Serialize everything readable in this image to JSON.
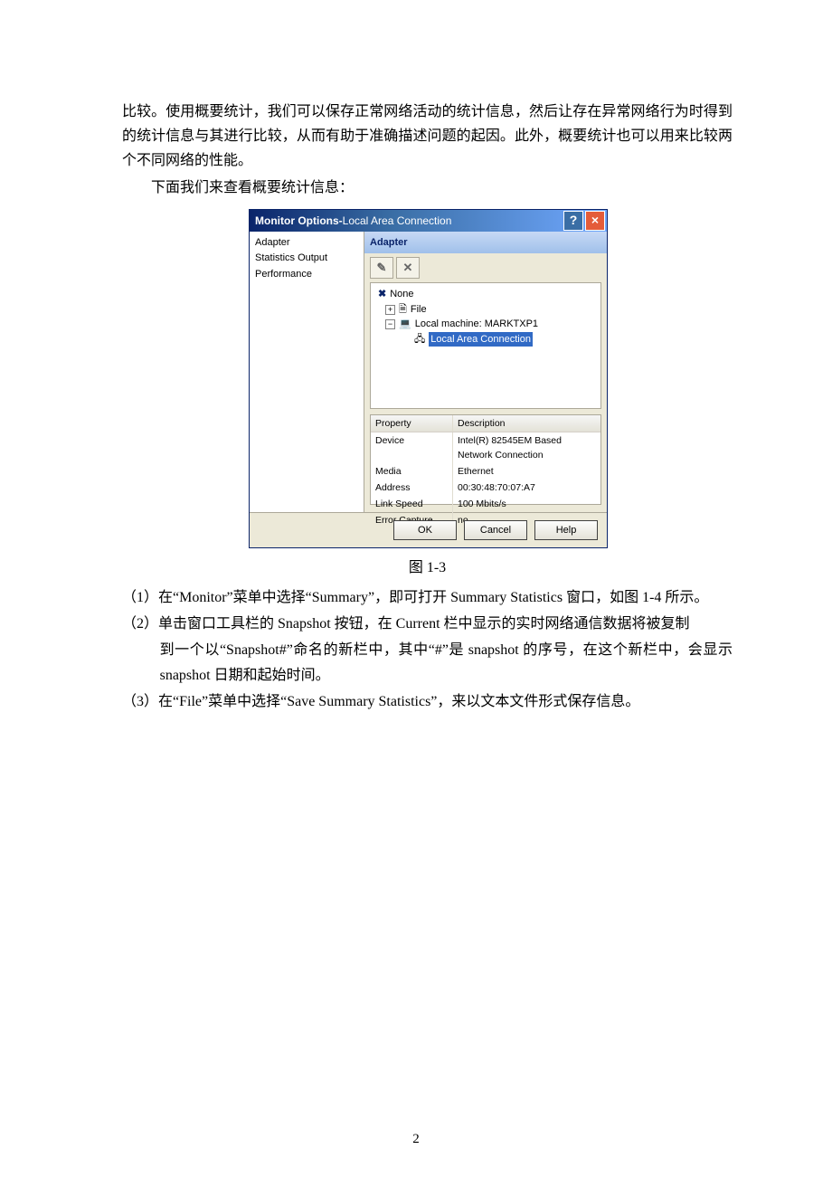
{
  "para1": "比较。使用概要统计，我们可以保存正常网络活动的统计信息，然后让存在异常网络行为时得到的统计信息与其进行比较，从而有助于准确描述问题的起因。此外，概要统计也可以用来比较两个不同网络的性能。",
  "para2": "下面我们来查看概要统计信息：",
  "dialog": {
    "title_main": "Monitor Options",
    "title_sep": " - ",
    "title_sub": "Local Area Connection",
    "help_glyph": "?",
    "close_glyph": "×",
    "nav": [
      "Adapter",
      "Statistics Output",
      "Performance"
    ],
    "group_label": "Adapter",
    "tool_edit": "✎",
    "tool_delete": "✕",
    "tree": {
      "none": "None",
      "file": "File",
      "local": "Local machine: MARKTXP1",
      "conn": "Local Area Connection"
    },
    "prop_headers": {
      "a": "Property",
      "b": "Description"
    },
    "props": [
      {
        "a": "Device",
        "b": "Intel(R) 82545EM Based Network Connection"
      },
      {
        "a": "Media",
        "b": "Ethernet"
      },
      {
        "a": "Address",
        "b": "00:30:48:70:07:A7"
      },
      {
        "a": "Link Speed",
        "b": "100 Mbits/s"
      },
      {
        "a": "Error Capture",
        "b": "no"
      }
    ],
    "buttons": {
      "ok": "OK",
      "cancel": "Cancel",
      "help": "Help"
    }
  },
  "fig_caption": "图 1-3",
  "step1": "（1）在“Monitor”菜单中选择“Summary”，即可打开 Summary Statistics 窗口，如图 1-4 所示。",
  "step2a": "（2）单击窗口工具栏的 Snapshot 按钮，在 Current 栏中显示的实时网络通信数据将被复制",
  "step2b": "到一个以“Snapshot#”命名的新栏中，其中“#”是 snapshot 的序号，在这个新栏中，会显示 snapshot 日期和起始时间。",
  "step3": "（3）在“File”菜单中选择“Save Summary Statistics”，来以文本文件形式保存信息。",
  "page_num": "2"
}
